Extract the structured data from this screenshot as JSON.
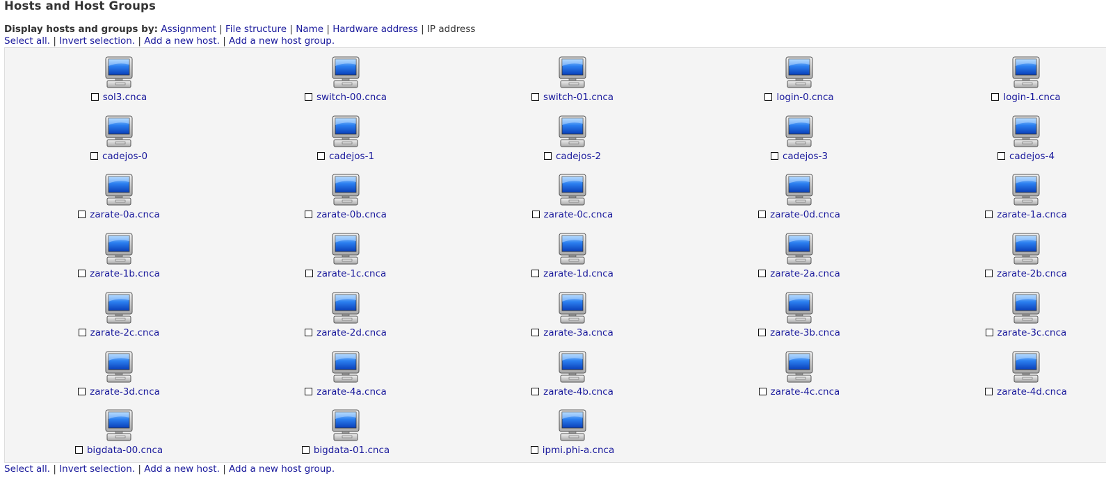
{
  "page": {
    "title": "Hosts and Host Groups"
  },
  "display_by": {
    "label": "Display hosts and groups by:",
    "options": [
      {
        "text": "Assignment",
        "link": true
      },
      {
        "text": "File structure",
        "link": true
      },
      {
        "text": "Name",
        "link": true
      },
      {
        "text": "Hardware address",
        "link": true
      },
      {
        "text": "IP address",
        "link": false
      }
    ]
  },
  "actions": {
    "select_all": "Select all.",
    "invert_selection": "Invert selection.",
    "add_host": "Add a new host.",
    "add_host_group": "Add a new host group.",
    "separator": "|"
  },
  "icon": "computer-icon",
  "colors": {
    "link": "#1a1a9c",
    "panel_bg": "#f4f4f4",
    "screen_blue": "#1f6fe0"
  },
  "hosts": [
    "sol3.cnca",
    "switch-00.cnca",
    "switch-01.cnca",
    "login-0.cnca",
    "login-1.cnca",
    "cadejos-0",
    "cadejos-1",
    "cadejos-2",
    "cadejos-3",
    "cadejos-4",
    "zarate-0a.cnca",
    "zarate-0b.cnca",
    "zarate-0c.cnca",
    "zarate-0d.cnca",
    "zarate-1a.cnca",
    "zarate-1b.cnca",
    "zarate-1c.cnca",
    "zarate-1d.cnca",
    "zarate-2a.cnca",
    "zarate-2b.cnca",
    "zarate-2c.cnca",
    "zarate-2d.cnca",
    "zarate-3a.cnca",
    "zarate-3b.cnca",
    "zarate-3c.cnca",
    "zarate-3d.cnca",
    "zarate-4a.cnca",
    "zarate-4b.cnca",
    "zarate-4c.cnca",
    "zarate-4d.cnca",
    "bigdata-00.cnca",
    "bigdata-01.cnca",
    "ipmi.phi-a.cnca"
  ]
}
